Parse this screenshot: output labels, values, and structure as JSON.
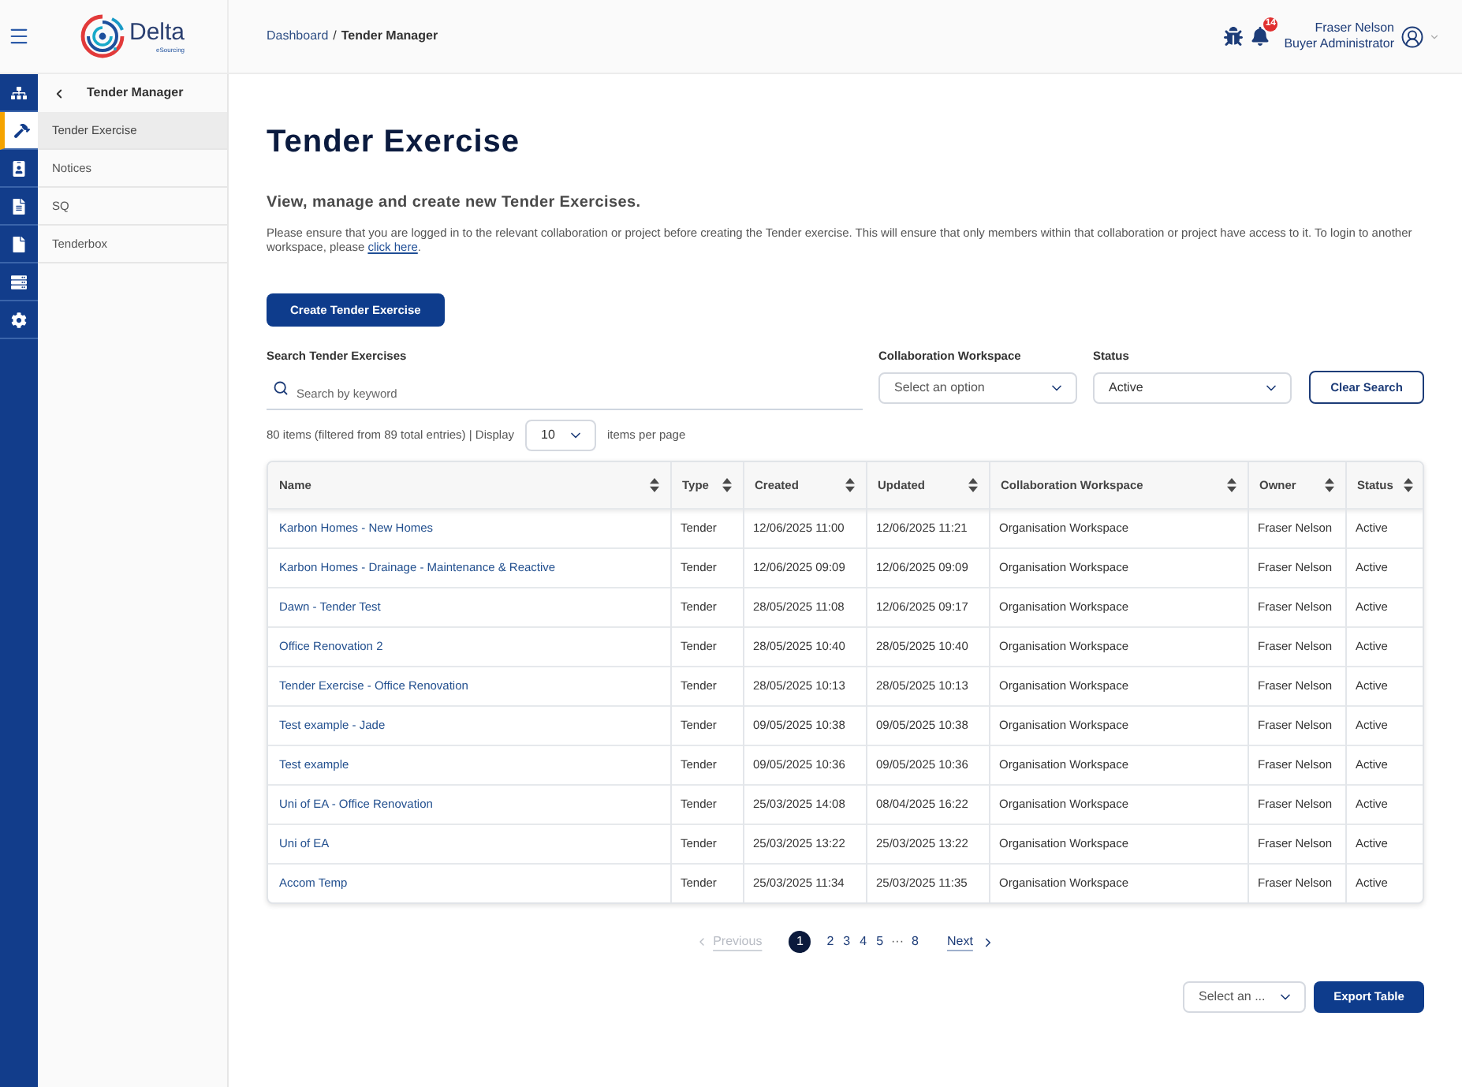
{
  "header": {
    "logo": {
      "name": "Delta",
      "tagline": "eSourcing"
    },
    "breadcrumb": {
      "separator": "/",
      "items": [
        {
          "label": "Dashboard",
          "kind": "link"
        },
        {
          "label": "Tender Manager",
          "kind": "current"
        }
      ]
    },
    "notifications": {
      "count": "14"
    },
    "user": {
      "name": "Fraser Nelson",
      "role": "Buyer Administrator"
    }
  },
  "rail": {
    "items": [
      {
        "selected": false
      },
      {
        "selected": true
      },
      {
        "selected": false
      },
      {
        "selected": false
      },
      {
        "selected": false
      },
      {
        "selected": false
      },
      {
        "selected": false
      }
    ]
  },
  "sidebar": {
    "title": "Tender Manager",
    "items": [
      {
        "label": "Tender Exercise",
        "selected": true
      },
      {
        "label": "Notices",
        "selected": false
      },
      {
        "label": "SQ",
        "selected": false
      },
      {
        "label": "Tenderbox",
        "selected": false
      }
    ]
  },
  "page": {
    "title": "Tender Exercise",
    "subtitle": "View, manage and create new Tender Exercises.",
    "notice": "Please ensure that you are logged in to the relevant collaboration or project before creating the Tender exercise. This will ensure that only members within that collaboration or project have access to it. To login to another workspace, please ",
    "notice_link": "click here",
    "notice_end": ".",
    "create_button": "Create Tender Exercise"
  },
  "filters": {
    "search": {
      "label": "Search Tender Exercises",
      "placeholder": "Search by keyword"
    },
    "workspace": {
      "label": "Collaboration Workspace",
      "placeholder": "Select an option"
    },
    "status": {
      "label": "Status",
      "value": "Active"
    },
    "clear_button": "Clear Search"
  },
  "summary": {
    "count_text": "80 items (filtered from 89 total entries) | Display",
    "page_size": "10",
    "per_page_text": "items per page"
  },
  "table": {
    "columns": [
      {
        "label": "Name",
        "kind": "link"
      },
      {
        "label": "Type",
        "kind": "text"
      },
      {
        "label": "Created",
        "kind": "text"
      },
      {
        "label": "Updated",
        "kind": "text"
      },
      {
        "label": "Collaboration Workspace",
        "kind": "text"
      },
      {
        "label": "Owner",
        "kind": "text"
      },
      {
        "label": "Status",
        "kind": "text"
      }
    ],
    "rows": [
      [
        "Karbon Homes - New Homes",
        "Tender",
        "12/06/2025 11:00",
        "12/06/2025 11:21",
        "Organisation Workspace",
        "Fraser Nelson",
        "Active"
      ],
      [
        "Karbon Homes - Drainage - Maintenance & Reactive",
        "Tender",
        "12/06/2025 09:09",
        "12/06/2025 09:09",
        "Organisation Workspace",
        "Fraser Nelson",
        "Active"
      ],
      [
        "Dawn - Tender Test",
        "Tender",
        "28/05/2025 11:08",
        "12/06/2025 09:17",
        "Organisation Workspace",
        "Fraser Nelson",
        "Active"
      ],
      [
        "Office Renovation 2",
        "Tender",
        "28/05/2025 10:40",
        "28/05/2025 10:40",
        "Organisation Workspace",
        "Fraser Nelson",
        "Active"
      ],
      [
        "Tender Exercise - Office Renovation",
        "Tender",
        "28/05/2025 10:13",
        "28/05/2025 10:13",
        "Organisation Workspace",
        "Fraser Nelson",
        "Active"
      ],
      [
        "Test example - Jade",
        "Tender",
        "09/05/2025 10:38",
        "09/05/2025 10:38",
        "Organisation Workspace",
        "Fraser Nelson",
        "Active"
      ],
      [
        "Test example",
        "Tender",
        "09/05/2025 10:36",
        "09/05/2025 10:36",
        "Organisation Workspace",
        "Fraser Nelson",
        "Active"
      ],
      [
        "Uni of EA - Office Renovation",
        "Tender",
        "25/03/2025 14:08",
        "08/04/2025 16:22",
        "Organisation Workspace",
        "Fraser Nelson",
        "Active"
      ],
      [
        "Uni of EA",
        "Tender",
        "25/03/2025 13:22",
        "25/03/2025 13:22",
        "Organisation Workspace",
        "Fraser Nelson",
        "Active"
      ],
      [
        "Accom Temp",
        "Tender",
        "25/03/2025 11:34",
        "25/03/2025 11:35",
        "Organisation Workspace",
        "Fraser Nelson",
        "Active"
      ]
    ]
  },
  "pagination": {
    "previous": {
      "label": "Previous",
      "disabled": true
    },
    "pages": [
      {
        "label": "1",
        "kind": "page",
        "selected": true
      },
      {
        "label": "2",
        "kind": "page",
        "selected": false
      },
      {
        "label": "3",
        "kind": "page",
        "selected": false
      },
      {
        "label": "4",
        "kind": "page",
        "selected": false
      },
      {
        "label": "5",
        "kind": "page",
        "selected": false
      },
      {
        "label": "···",
        "kind": "ellipsis",
        "selected": false
      },
      {
        "label": "8",
        "kind": "page",
        "selected": false
      }
    ],
    "next": {
      "label": "Next",
      "disabled": false
    }
  },
  "export": {
    "placeholder": "Select an ...",
    "button": "Export Table"
  }
}
